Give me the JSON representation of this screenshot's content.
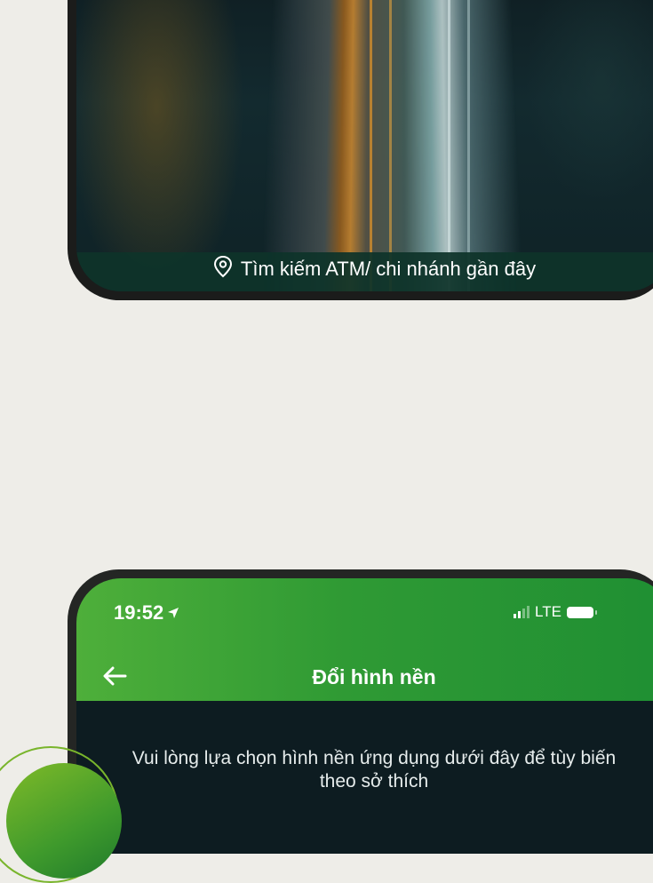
{
  "top_phone": {
    "atm_search": {
      "icon": "location-pin-icon",
      "label": "Tìm kiếm ATM/ chi nhánh gần đây"
    }
  },
  "bottom_phone": {
    "status_bar": {
      "time": "19:52",
      "location_icon": "location-arrow-icon",
      "network": "LTE",
      "battery_icon": "battery-icon"
    },
    "header": {
      "back_icon": "back-arrow-icon",
      "title": "Đổi hình nền"
    },
    "instruction": "Vui lòng lựa chọn hình nền ứng dụng dưới đây để tùy biến theo sở thích"
  },
  "colors": {
    "page_background": "#eeede8",
    "header_green_start": "#4eaf3a",
    "header_green_end": "#1f8f33",
    "atm_bar": "#0e342a",
    "screen_dark": "#0d1c21",
    "decor_green": "#79b52c"
  }
}
